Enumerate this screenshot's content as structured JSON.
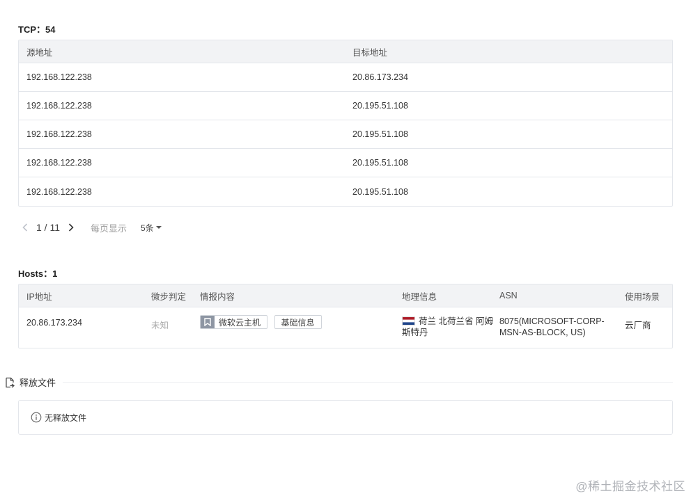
{
  "tcp": {
    "title": "TCP：54",
    "columns": {
      "src": "源地址",
      "dst": "目标地址"
    },
    "rows": [
      {
        "src": "192.168.122.238",
        "dst": "20.86.173.234"
      },
      {
        "src": "192.168.122.238",
        "dst": "20.195.51.108"
      },
      {
        "src": "192.168.122.238",
        "dst": "20.195.51.108"
      },
      {
        "src": "192.168.122.238",
        "dst": "20.195.51.108"
      },
      {
        "src": "192.168.122.238",
        "dst": "20.195.51.108"
      }
    ]
  },
  "pager": {
    "page_text": "1 / 11",
    "per_page_label": "每页显示",
    "per_page_value": "5条",
    "icons": {
      "prev": "chevron-left-icon",
      "next": "chevron-right-icon",
      "caret": "caret-down-icon"
    }
  },
  "hosts": {
    "title": "Hosts：1",
    "columns": {
      "ip": "IP地址",
      "judge": "微步判定",
      "intel": "情报内容",
      "geo": "地理信息",
      "asn": "ASN",
      "use": "使用场景"
    },
    "rows": [
      {
        "ip": "20.86.173.234",
        "judge": "未知",
        "intel_tag": "微软云主机",
        "intel_button": "基础信息",
        "geo": "荷兰 北荷兰省 阿姆斯特丹",
        "asn": "8075(MICROSOFT-CORP-MSN-AS-BLOCK, US)",
        "use": "云厂商"
      }
    ]
  },
  "release": {
    "title": "释放文件",
    "empty_text": "无释放文件"
  },
  "watermark": "@稀土掘金技术社区",
  "colors": {
    "header_bg": "#f2f3f5",
    "border": "#e3e6eb",
    "muted": "#999999",
    "tag_icon_bg": "#8e96a3"
  }
}
